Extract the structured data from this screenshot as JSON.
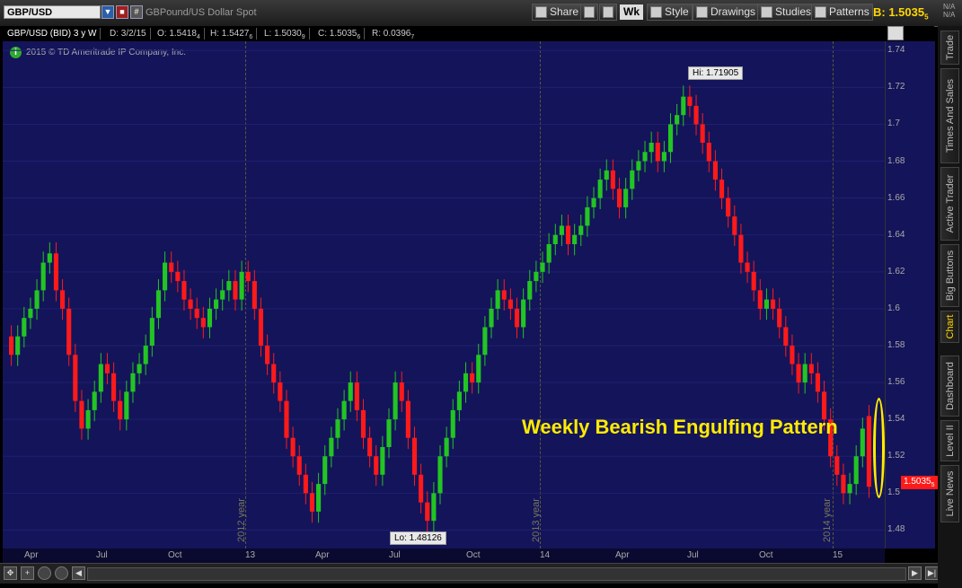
{
  "toolbar": {
    "symbol": "GBP/USD",
    "description": "GBPound/US Dollar Spot",
    "share_label": "Share",
    "timeframe_label": "Wk",
    "style_label": "Style",
    "drawings_label": "Drawings",
    "studies_label": "Studies",
    "patterns_label": "Patterns",
    "bid_label": "B: 1.5035",
    "bid_sub": "5",
    "na_top": "N/A",
    "na_bottom": "N/A"
  },
  "info_bar": {
    "instrument": "GBP/USD (BID) 3 y W",
    "date": "D: 3/2/15",
    "open": "O: 1.5418",
    "open_sub": "4",
    "high": "H: 1.5427",
    "high_sub": "6",
    "low": "L: 1.5030",
    "low_sub": "9",
    "close": "C: 1.5035",
    "close_sub": "6",
    "range": "R: 0.0396",
    "range_sub": "7"
  },
  "copyright": "2015 © TD Ameritrade IP Company, Inc.",
  "side_tabs": [
    "Trade",
    "Times And Sales",
    "Active Trader",
    "Big Buttons",
    "Chart",
    "Dashboard",
    "Level II",
    "Live News"
  ],
  "active_side_tab": "Chart",
  "chart_data": {
    "type": "candlestick",
    "y_ticks": [
      "1.74",
      "1.72",
      "1.7",
      "1.68",
      "1.66",
      "1.64",
      "1.62",
      "1.6",
      "1.58",
      "1.56",
      "1.54",
      "1.52",
      "1.5",
      "1.48"
    ],
    "ylim": [
      1.47,
      1.745
    ],
    "x_ticks": [
      "Apr",
      "Jul",
      "Oct",
      "13",
      "Apr",
      "Jul",
      "Oct",
      "14",
      "Apr",
      "Jul",
      "Oct",
      "15"
    ],
    "year_markers": [
      "2012 year",
      "2013 year",
      "2014 year"
    ],
    "hi_label": "Hi: 1.71905",
    "lo_label": "Lo: 1.48126",
    "last_price": "1.5035",
    "last_price_sub": "5",
    "annotation": "Weekly Bearish Engulfing Pattern",
    "colors": {
      "up": "#22c522",
      "down": "#ff1a1a",
      "background": "#14145a"
    },
    "closes": [
      1.575,
      1.585,
      1.595,
      1.6,
      1.61,
      1.625,
      1.63,
      1.61,
      1.6,
      1.575,
      1.55,
      1.535,
      1.545,
      1.555,
      1.57,
      1.565,
      1.55,
      1.54,
      1.555,
      1.565,
      1.57,
      1.58,
      1.595,
      1.61,
      1.625,
      1.62,
      1.615,
      1.605,
      1.6,
      1.595,
      1.59,
      1.6,
      1.605,
      1.61,
      1.615,
      1.605,
      1.62,
      1.615,
      1.6,
      1.58,
      1.57,
      1.56,
      1.55,
      1.53,
      1.52,
      1.51,
      1.5,
      1.49,
      1.505,
      1.52,
      1.53,
      1.54,
      1.55,
      1.56,
      1.545,
      1.53,
      1.52,
      1.51,
      1.525,
      1.54,
      1.56,
      1.55,
      1.53,
      1.51,
      1.495,
      1.485,
      1.5,
      1.52,
      1.53,
      1.545,
      1.555,
      1.565,
      1.56,
      1.575,
      1.59,
      1.6,
      1.61,
      1.605,
      1.6,
      1.59,
      1.605,
      1.615,
      1.62,
      1.625,
      1.635,
      1.64,
      1.645,
      1.635,
      1.64,
      1.645,
      1.655,
      1.66,
      1.67,
      1.675,
      1.665,
      1.655,
      1.665,
      1.675,
      1.68,
      1.685,
      1.69,
      1.68,
      1.685,
      1.7,
      1.705,
      1.715,
      1.71,
      1.7,
      1.69,
      1.68,
      1.67,
      1.66,
      1.65,
      1.64,
      1.625,
      1.62,
      1.61,
      1.6,
      1.605,
      1.6,
      1.59,
      1.58,
      1.57,
      1.56,
      1.57,
      1.565,
      1.555,
      1.54,
      1.52,
      1.51,
      1.5,
      1.505,
      1.52,
      1.535,
      1.5035
    ]
  }
}
